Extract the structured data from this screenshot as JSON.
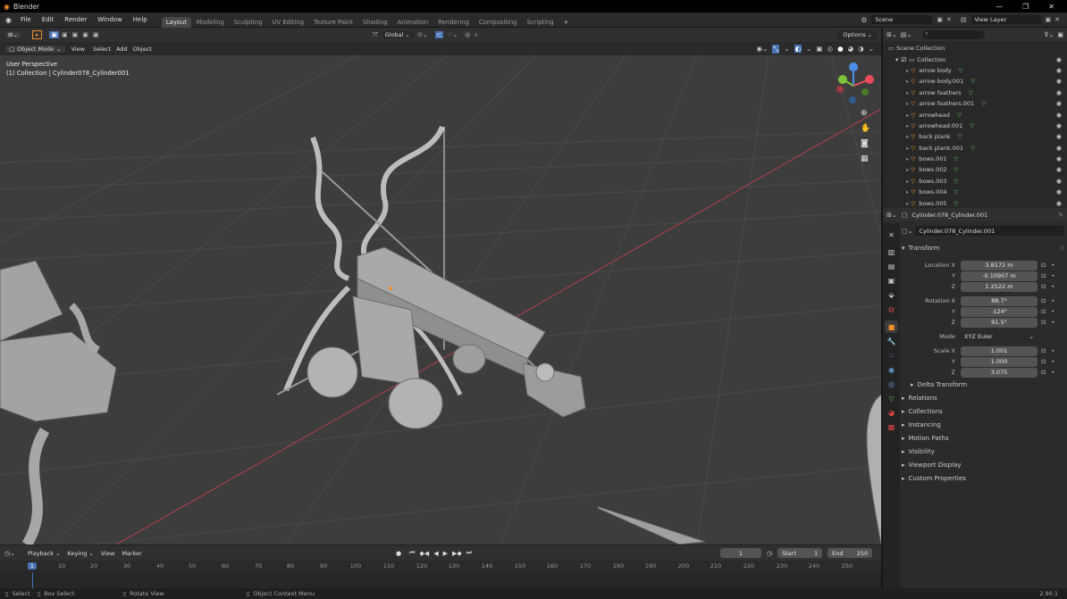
{
  "app": {
    "title": "Blender"
  },
  "menu": [
    "File",
    "Edit",
    "Render",
    "Window",
    "Help"
  ],
  "workspace_tabs": [
    "Layout",
    "Modeling",
    "Sculpting",
    "UV Editing",
    "Texture Paint",
    "Shading",
    "Animation",
    "Rendering",
    "Compositing",
    "Scripting"
  ],
  "scene": {
    "name": "Scene",
    "view_layer": "View Layer"
  },
  "viewport": {
    "orientation": "Global",
    "mode": "Object Mode",
    "menus": [
      "View",
      "Select",
      "Add",
      "Object"
    ],
    "options": "Options",
    "overlay_line1": "User Perspective",
    "overlay_line2": "(1) Collection | Cylinder078_Cylinder001"
  },
  "outliner": {
    "root": "Scene Collection",
    "collection": "Collection",
    "items": [
      "arrow body",
      "arrow body.001",
      "arrow feathers",
      "arrow feathers.001",
      "arrowhead",
      "arrowhead.001",
      "back plank",
      "back plank.001",
      "bows.001",
      "bows.002",
      "bows.003",
      "bows.004",
      "bows.005"
    ]
  },
  "properties": {
    "object_name": "Cylinder.078_Cylinder.001",
    "object_field": "Cylinder.078_Cylinder.001",
    "transform_label": "Transform",
    "location_label": "Location X",
    "location": [
      "3.8172 m",
      "-0.10907 m",
      "1.2522 m"
    ],
    "rotation_label": "Rotation X",
    "rotation": [
      "88.7°",
      "-124°",
      "91.5°"
    ],
    "mode_label": "Mode",
    "mode_value": "XYZ Euler",
    "scale_label": "Scale X",
    "scale": [
      "1.001",
      "1.000",
      "3.075"
    ],
    "axis_y": "Y",
    "axis_z": "Z",
    "delta": "Delta Transform",
    "panels": [
      "Relations",
      "Collections",
      "Instancing",
      "Motion Paths",
      "Visibility",
      "Viewport Display",
      "Custom Properties"
    ]
  },
  "timeline": {
    "menus": [
      "Playback",
      "Keying",
      "View",
      "Marker"
    ],
    "current_frame": "1",
    "start_label": "Start",
    "start": "1",
    "end_label": "End",
    "end": "250",
    "ticks": [
      "1",
      "10",
      "20",
      "30",
      "40",
      "50",
      "60",
      "70",
      "80",
      "90",
      "100",
      "110",
      "120",
      "130",
      "140",
      "150",
      "160",
      "170",
      "180",
      "190",
      "200",
      "210",
      "220",
      "230",
      "240",
      "250"
    ]
  },
  "status": {
    "select": "Select",
    "box_select": "Box Select",
    "rotate": "Rotate View",
    "context": "Object Context Menu",
    "version": "2.90.1"
  },
  "colors": {
    "accent": "#4772b3",
    "orange": "#f08f2a",
    "axis_x": "#e94b5a",
    "axis_y": "#7cc13a",
    "axis_z": "#4b8fe9"
  }
}
